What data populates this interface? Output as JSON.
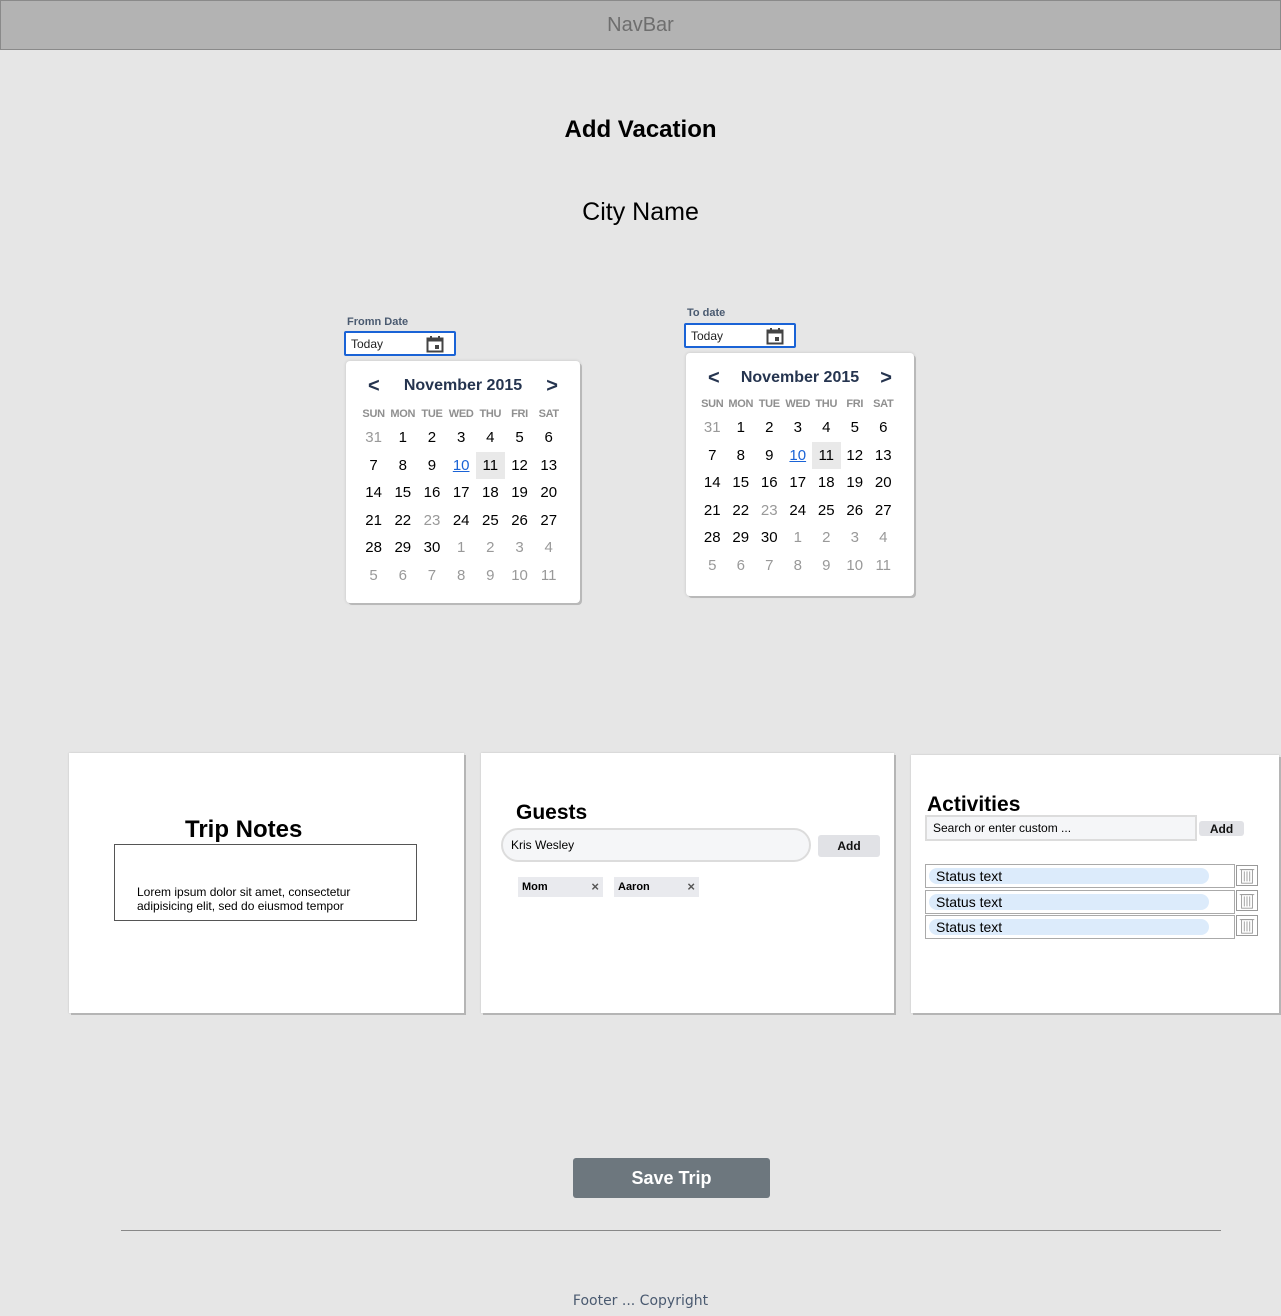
{
  "navbar": {
    "label": "NavBar"
  },
  "page": {
    "title": "Add Vacation",
    "city_name": "City Name"
  },
  "from_date": {
    "label": "Fromn Date",
    "value": "Today",
    "calendar": {
      "month": "November 2015",
      "prev": "<",
      "next": ">"
    }
  },
  "to_date": {
    "label": "To date",
    "value": "Today",
    "calendar": {
      "month": "November 2015",
      "prev": "<",
      "next": ">"
    }
  },
  "calendar_weekdays": [
    "SUN",
    "MON",
    "TUE",
    "WED",
    "THU",
    "FRI",
    "SAT"
  ],
  "calendar_days": [
    {
      "d": "31",
      "other": true
    },
    {
      "d": "1"
    },
    {
      "d": "2"
    },
    {
      "d": "3"
    },
    {
      "d": "4"
    },
    {
      "d": "5"
    },
    {
      "d": "6"
    },
    {
      "d": "7"
    },
    {
      "d": "8"
    },
    {
      "d": "9"
    },
    {
      "d": "10",
      "today": true
    },
    {
      "d": "11",
      "selected": true
    },
    {
      "d": "12"
    },
    {
      "d": "13"
    },
    {
      "d": "14"
    },
    {
      "d": "15"
    },
    {
      "d": "16"
    },
    {
      "d": "17"
    },
    {
      "d": "18"
    },
    {
      "d": "19"
    },
    {
      "d": "20"
    },
    {
      "d": "21"
    },
    {
      "d": "22"
    },
    {
      "d": "23",
      "other": true
    },
    {
      "d": "24"
    },
    {
      "d": "25"
    },
    {
      "d": "26"
    },
    {
      "d": "27"
    },
    {
      "d": "28"
    },
    {
      "d": "29"
    },
    {
      "d": "30"
    },
    {
      "d": "1",
      "other": true
    },
    {
      "d": "2",
      "other": true
    },
    {
      "d": "3",
      "other": true
    },
    {
      "d": "4",
      "other": true
    },
    {
      "d": "5",
      "other": true
    },
    {
      "d": "6",
      "other": true
    },
    {
      "d": "7",
      "other": true
    },
    {
      "d": "8",
      "other": true
    },
    {
      "d": "9",
      "other": true
    },
    {
      "d": "10",
      "other": true
    },
    {
      "d": "11",
      "other": true
    }
  ],
  "trip_notes": {
    "title": "Trip Notes",
    "text": "Lorem ipsum dolor sit amet, consectetur adipisicing elit, sed do eiusmod tempor"
  },
  "guests": {
    "title": "Guests",
    "input_value": "Kris Wesley",
    "add_label": "Add",
    "chips": [
      "Mom",
      "Aaron"
    ],
    "chip_remove": "×"
  },
  "activities": {
    "title": "Activities",
    "placeholder": "Search or enter custom ...",
    "add_label": "Add",
    "items": [
      "Status text",
      "Status text",
      "Status text"
    ]
  },
  "save_button": {
    "label": "Save Trip"
  },
  "footer": {
    "text": "Footer ... Copyright"
  },
  "colors": {
    "background": "#e6e6e6",
    "navbar": "#b3b3b3",
    "accent_blue": "#1a63d6",
    "save_button": "#6d777e",
    "status_pill": "#dcebfb"
  }
}
